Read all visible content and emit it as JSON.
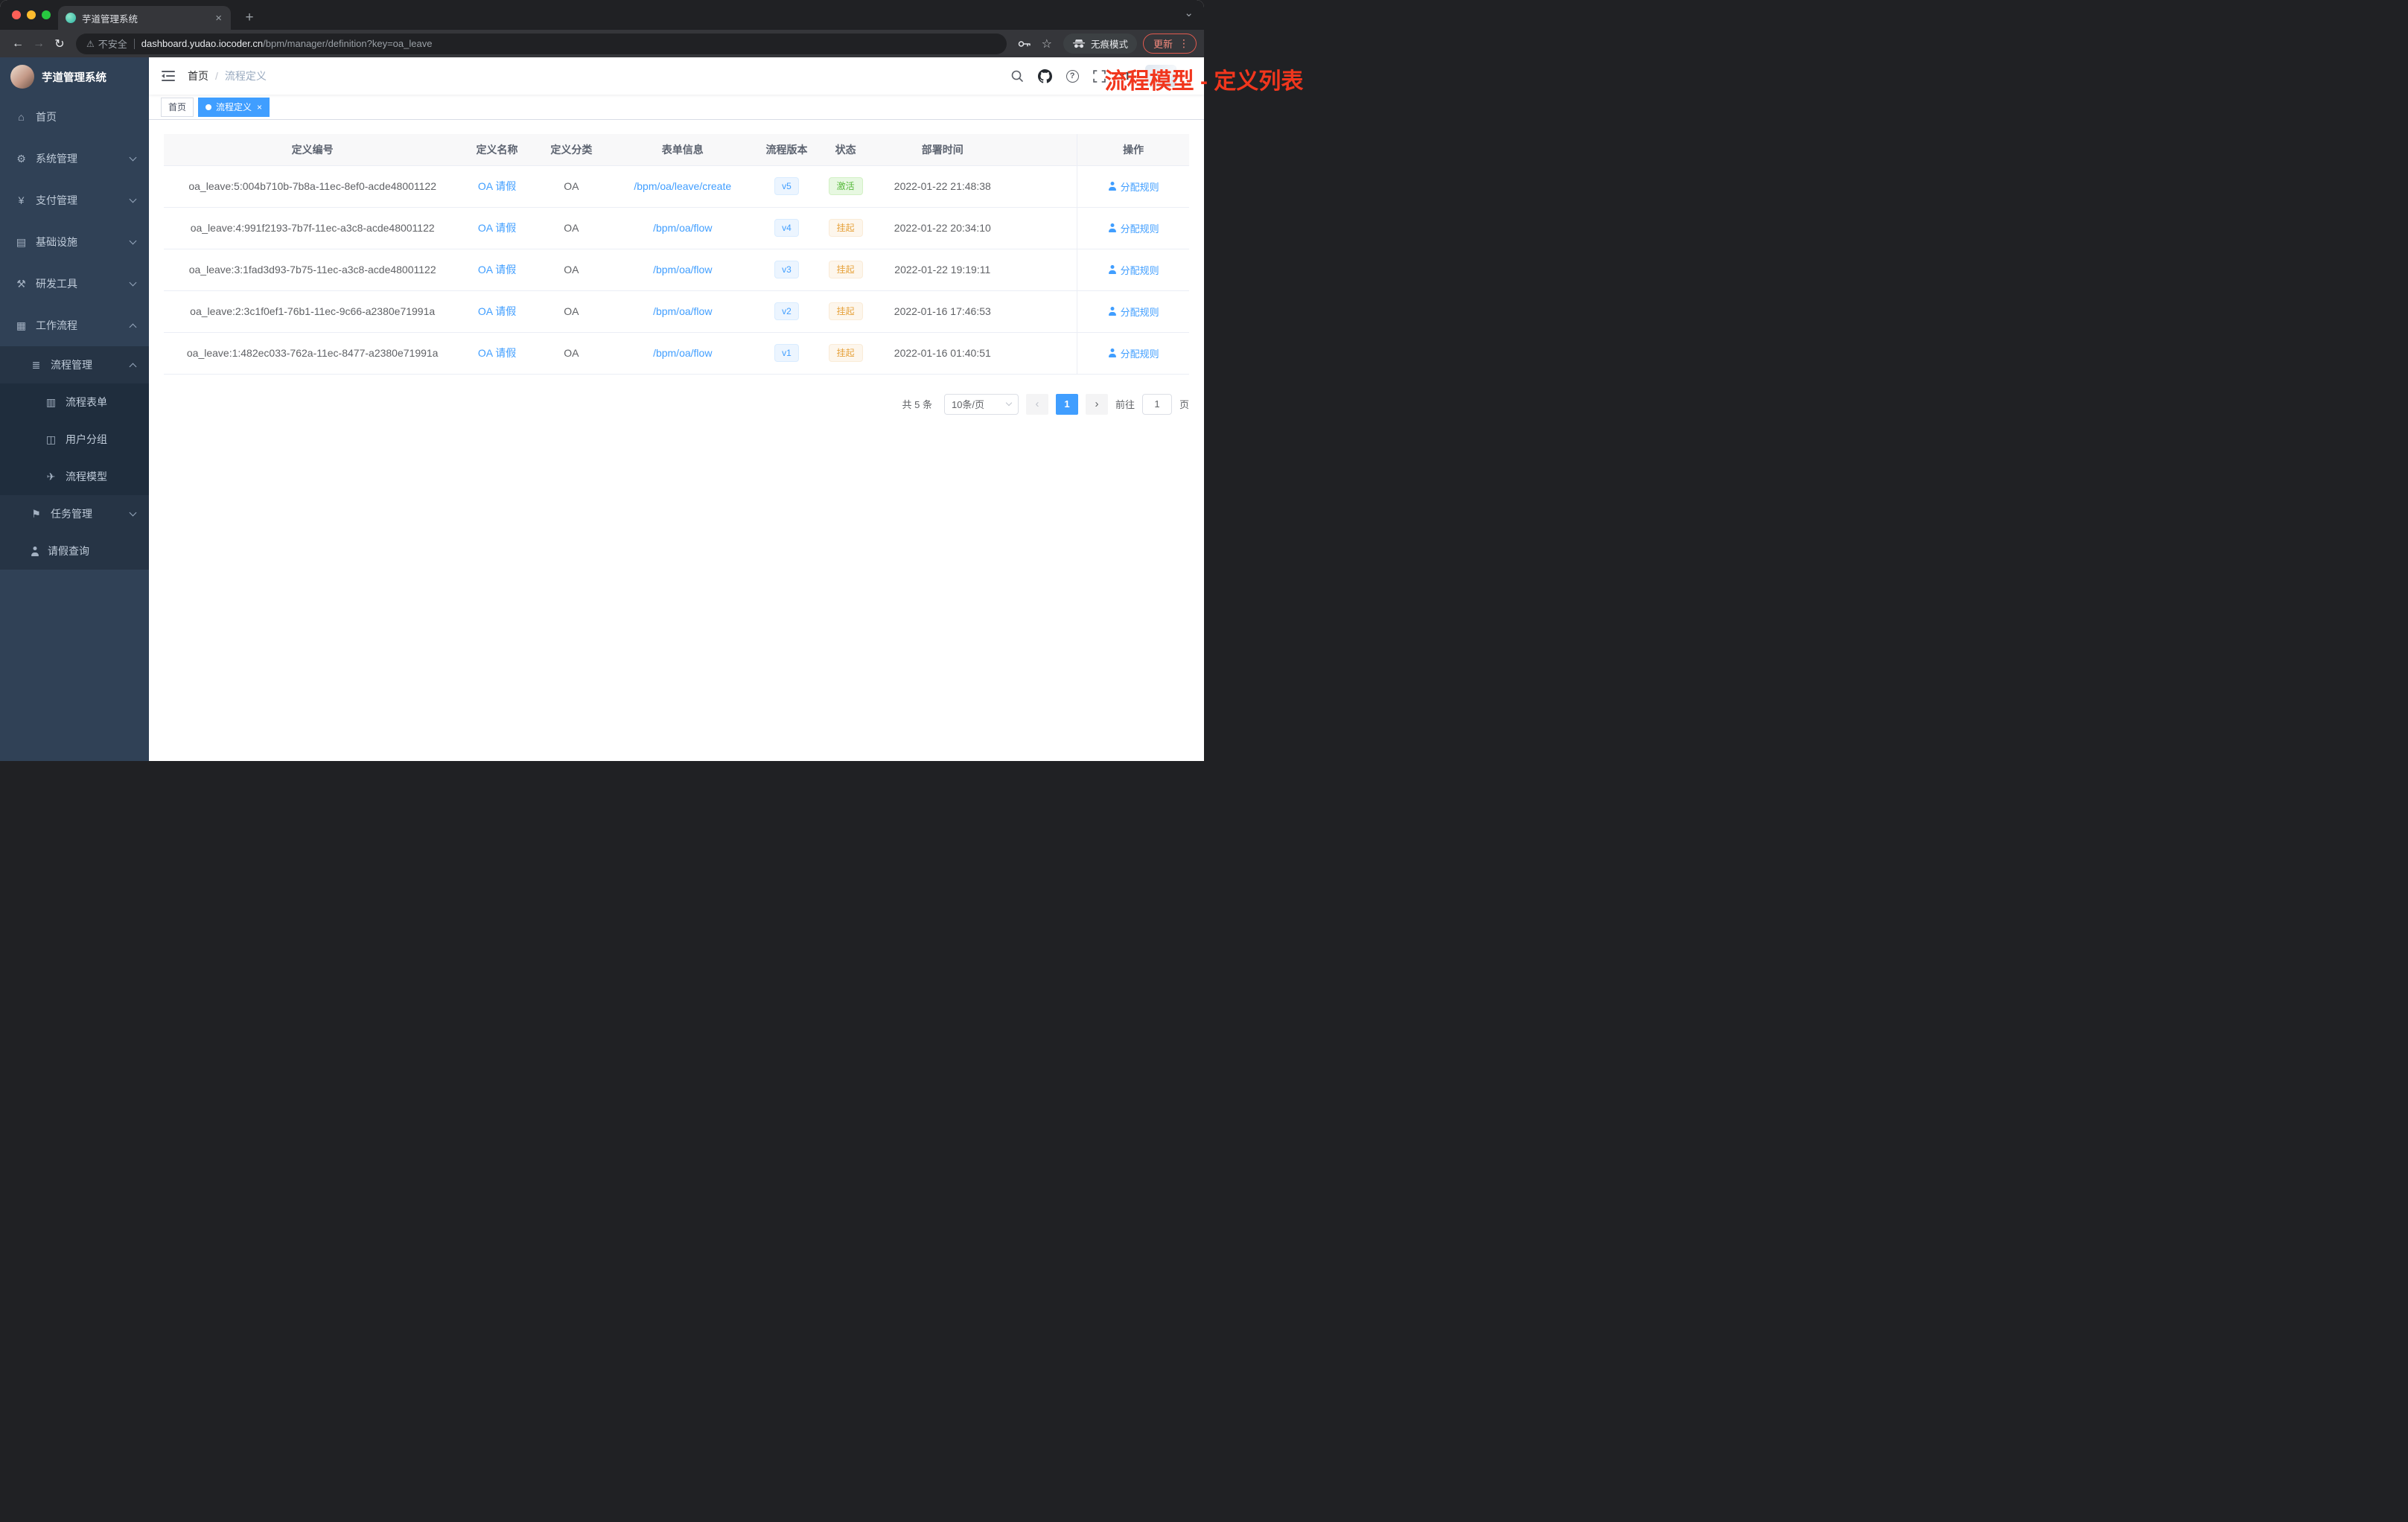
{
  "browser": {
    "tab_title": "芋道管理系统",
    "security_label": "不安全",
    "url_host": "dashboard.yudao.iocoder.cn",
    "url_path": "/bpm/manager/definition?key=oa_leave",
    "incognito_label": "无痕模式",
    "update_label": "更新"
  },
  "icons": {
    "back": "←",
    "forward": "→",
    "reload": "↻",
    "plus": "+",
    "close": "×",
    "caret_down": "⌄",
    "warning": "⚠",
    "star": "☆",
    "kebab": "⋮",
    "prev": "‹",
    "next": "›",
    "question": "?"
  },
  "sidebar": {
    "brand": "芋道管理系统",
    "items": [
      {
        "key": "home",
        "label": "首页",
        "icon": "dashboard-icon",
        "glyph": "⌂",
        "level": 1
      },
      {
        "key": "system",
        "label": "系统管理",
        "icon": "gear-icon",
        "glyph": "⚙",
        "level": 1,
        "chevron": "down"
      },
      {
        "key": "payment",
        "label": "支付管理",
        "icon": "yen-icon",
        "glyph": "¥",
        "level": 1,
        "chevron": "down"
      },
      {
        "key": "infrastructure",
        "label": "基础设施",
        "icon": "infrastructure-icon",
        "glyph": "▤",
        "level": 1,
        "chevron": "down"
      },
      {
        "key": "devtools",
        "label": "研发工具",
        "icon": "tools-icon",
        "glyph": "⚒",
        "level": 1,
        "chevron": "down"
      },
      {
        "key": "workflow",
        "label": "工作流程",
        "icon": "briefcase-icon",
        "glyph": "▦",
        "level": 1,
        "chevron": "up"
      },
      {
        "key": "process-mgmt",
        "label": "流程管理",
        "icon": "list-icon",
        "glyph": "≣",
        "level": 2,
        "chevron": "up"
      },
      {
        "key": "process-form",
        "label": "流程表单",
        "icon": "form-icon",
        "glyph": "▥",
        "level": 3
      },
      {
        "key": "user-group",
        "label": "用户分组",
        "icon": "group-icon",
        "glyph": "◫",
        "level": 3
      },
      {
        "key": "process-model",
        "label": "流程模型",
        "icon": "paper-plane-icon",
        "glyph": "✈",
        "level": 3
      },
      {
        "key": "task-mgmt",
        "label": "任务管理",
        "icon": "flag-icon",
        "glyph": "⚑",
        "level": 2,
        "chevron": "down"
      },
      {
        "key": "leave-query",
        "label": "请假查询",
        "icon": "person-icon",
        "glyph": "",
        "level": 2,
        "person": true
      }
    ]
  },
  "header": {
    "breadcrumb_home": "首页",
    "breadcrumb_sep": "/",
    "breadcrumb_current": "流程定义",
    "annotation": "流程模型 - 定义列表"
  },
  "tags": {
    "home": "首页",
    "current": "流程定义"
  },
  "table": {
    "columns": [
      "定义编号",
      "定义名称",
      "定义分类",
      "表单信息",
      "流程版本",
      "状态",
      "部署时间",
      "操作"
    ],
    "rows": [
      {
        "id": "oa_leave:5:004b710b-7b8a-11ec-8ef0-acde48001122",
        "name": "OA 请假",
        "category": "OA",
        "form": "/bpm/oa/leave/create",
        "version": "v5",
        "status": "激活",
        "status_type": "success",
        "deployed": "2022-01-22 21:48:38",
        "action": "分配规则"
      },
      {
        "id": "oa_leave:4:991f2193-7b7f-11ec-a3c8-acde48001122",
        "name": "OA 请假",
        "category": "OA",
        "form": "/bpm/oa/flow",
        "version": "v4",
        "status": "挂起",
        "status_type": "warning",
        "deployed": "2022-01-22 20:34:10",
        "action": "分配规则"
      },
      {
        "id": "oa_leave:3:1fad3d93-7b75-11ec-a3c8-acde48001122",
        "name": "OA 请假",
        "category": "OA",
        "form": "/bpm/oa/flow",
        "version": "v3",
        "status": "挂起",
        "status_type": "warning",
        "deployed": "2022-01-22 19:19:11",
        "action": "分配规则"
      },
      {
        "id": "oa_leave:2:3c1f0ef1-76b1-11ec-9c66-a2380e71991a",
        "name": "OA 请假",
        "category": "OA",
        "form": "/bpm/oa/flow",
        "version": "v2",
        "status": "挂起",
        "status_type": "warning",
        "deployed": "2022-01-16 17:46:53",
        "action": "分配规则"
      },
      {
        "id": "oa_leave:1:482ec033-762a-11ec-8477-a2380e71991a",
        "name": "OA 请假",
        "category": "OA",
        "form": "/bpm/oa/flow",
        "version": "v1",
        "status": "挂起",
        "status_type": "warning",
        "deployed": "2022-01-16 01:40:51",
        "action": "分配规则"
      }
    ]
  },
  "pagination": {
    "total": "共 5 条",
    "page_size": "10条/页",
    "current": "1",
    "goto_label": "前往",
    "goto_value": "1",
    "unit_label": "页"
  },
  "colors": {
    "accent": "#409eff",
    "annotation_red": "#f1361d",
    "success": "#57b93c",
    "warning": "#e6a23c"
  }
}
